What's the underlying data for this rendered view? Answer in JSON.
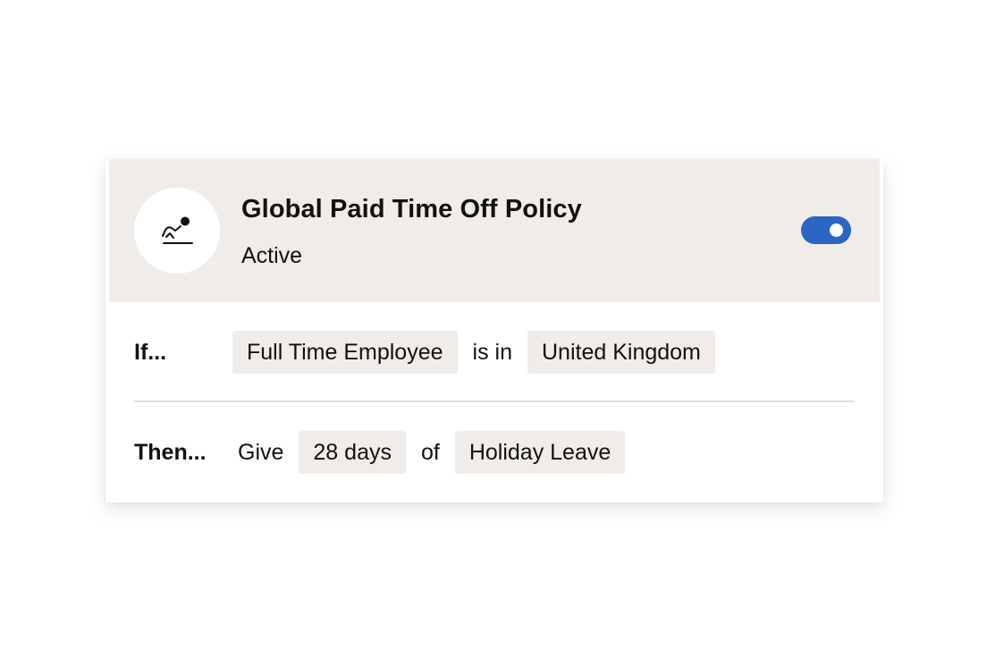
{
  "policy": {
    "title": "Global Paid Time Off Policy",
    "status": "Active",
    "icon": "holiday-person-icon",
    "enabled": true,
    "toggle_color": "#2a66c2",
    "header_bg": "#f0ece9"
  },
  "rules": {
    "if": {
      "label": "If...",
      "subject": "Full Time Employee",
      "operator": "is in",
      "value": "United Kingdom"
    },
    "then": {
      "label": "Then...",
      "action": "Give",
      "amount": "28 days",
      "connector": "of",
      "leave_type": "Holiday Leave"
    }
  }
}
